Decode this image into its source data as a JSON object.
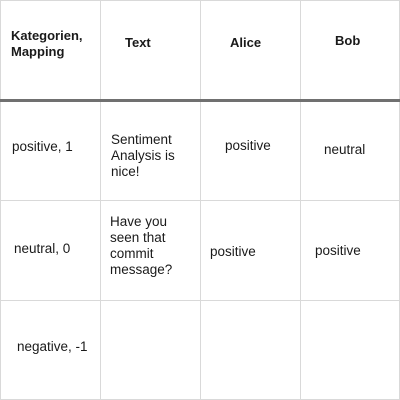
{
  "table": {
    "headers": {
      "category": "Kategorien,\nMapping",
      "text": "Text",
      "alice": "Alice",
      "bob": "Bob"
    },
    "rows": [
      {
        "category": "positive, 1",
        "text": "Sentiment\nAnalysis is\nnice!",
        "alice": "positive",
        "bob": "neutral"
      },
      {
        "category": "neutral, 0",
        "text": "Have you\nseen that\ncommit\nmessage?",
        "alice": "positive",
        "bob": "positive"
      },
      {
        "category": "negative, -1",
        "text": "",
        "alice": "",
        "bob": ""
      }
    ]
  }
}
